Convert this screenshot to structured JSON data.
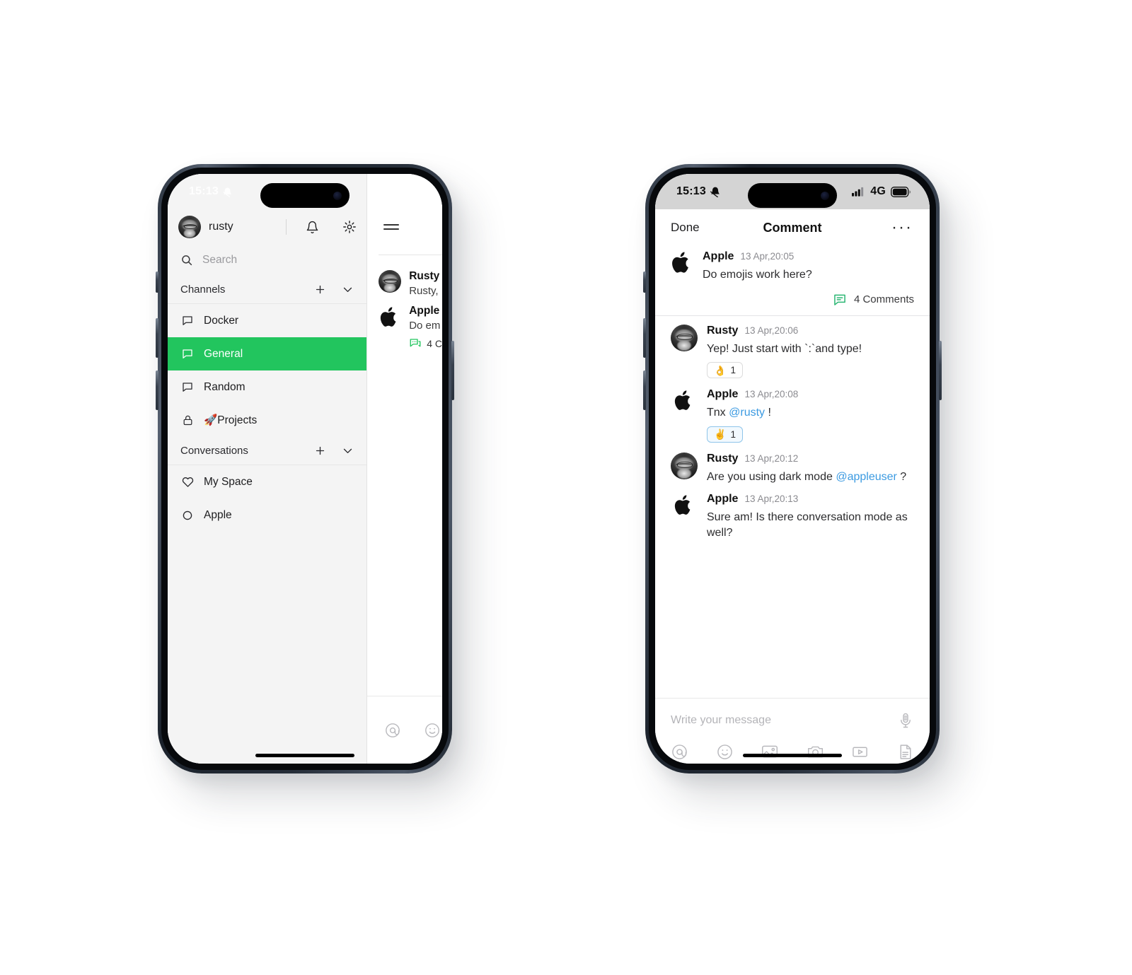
{
  "left_phone": {
    "status_bar": {
      "time": "15:13",
      "mute_icon": "bell-slash-icon"
    },
    "drawer": {
      "user": {
        "name": "rusty",
        "avatar": "user-avatar"
      },
      "bell_icon": "bell-icon",
      "settings_icon": "gear-icon",
      "search": {
        "placeholder": "Search",
        "icon": "search-icon"
      },
      "sections": [
        {
          "title": "Channels",
          "add_icon": "plus-icon",
          "collapse_icon": "chevron-down-icon",
          "items": [
            {
              "label": "Docker",
              "icon": "channel-icon",
              "active": false
            },
            {
              "label": "General",
              "icon": "channel-icon",
              "active": true
            },
            {
              "label": "Random",
              "icon": "channel-icon",
              "active": false
            },
            {
              "label": "🚀Projects",
              "icon": "lock-icon",
              "active": false
            }
          ]
        },
        {
          "title": "Conversations",
          "add_icon": "plus-icon",
          "collapse_icon": "chevron-down-icon",
          "items": [
            {
              "label": "My Space",
              "icon": "heart-icon",
              "active": false
            },
            {
              "label": "Apple",
              "icon": "circle-icon",
              "active": false
            }
          ]
        }
      ]
    },
    "chat": {
      "menu_icon": "hamburger-menu-icon",
      "messages": [
        {
          "author": "Rusty",
          "text": "Rusty,",
          "avatar": "user-avatar"
        },
        {
          "author": "Apple",
          "text": "Do em",
          "avatar": "apple-logo",
          "comments": "4 C"
        }
      ],
      "toolbar": [
        {
          "name": "mention-icon",
          "glyph": "@"
        },
        {
          "name": "emoji-icon",
          "glyph": "smiley"
        }
      ]
    }
  },
  "right_phone": {
    "status_bar": {
      "time": "15:13",
      "mute_icon": "bell-slash-icon",
      "signal_icon": "cellular-signal-icon",
      "network": "4G",
      "battery_icon": "battery-icon"
    },
    "nav": {
      "done_label": "Done",
      "title": "Comment",
      "more_icon": "more-horizontal-icon"
    },
    "root_post": {
      "author": "Apple",
      "avatar": "apple-logo",
      "time": "13 Apr,20:05",
      "text": "Do emojis work here?",
      "comments_icon": "comment-icon",
      "comments_label": "4 Comments"
    },
    "thread": [
      {
        "author": "Rusty",
        "avatar": "user-avatar",
        "time": "13 Apr,20:06",
        "text": "Yep! Just start with `:`and type!",
        "reactions": [
          {
            "emoji": "👌",
            "count": "1",
            "selected": false
          }
        ]
      },
      {
        "author": "Apple",
        "avatar": "apple-logo",
        "time": "13 Apr,20:08",
        "text_before": "Tnx ",
        "mention": "@rusty",
        "text_after": " !",
        "reactions": [
          {
            "emoji": "✌️",
            "count": "1",
            "selected": true
          }
        ]
      },
      {
        "author": "Rusty",
        "avatar": "user-avatar",
        "time": "13 Apr,20:12",
        "text_before": "Are you using dark mode ",
        "mention": "@appleuser",
        "text_after": " ?",
        "reactions": []
      },
      {
        "author": "Apple",
        "avatar": "apple-logo",
        "time": "13 Apr,20:13",
        "text": "Sure am! Is there conversation mode as well?",
        "reactions": []
      }
    ],
    "compose": {
      "placeholder": "Write your message",
      "mic_icon": "microphone-icon",
      "toolbar": [
        {
          "name": "mention-icon"
        },
        {
          "name": "emoji-icon"
        },
        {
          "name": "image-icon"
        },
        {
          "name": "camera-icon"
        },
        {
          "name": "video-icon"
        },
        {
          "name": "document-icon"
        }
      ]
    }
  },
  "colors": {
    "accent_green": "#22c55e",
    "mention_blue": "#3b9ae1",
    "reaction_selected_border": "#8fc5ea"
  }
}
